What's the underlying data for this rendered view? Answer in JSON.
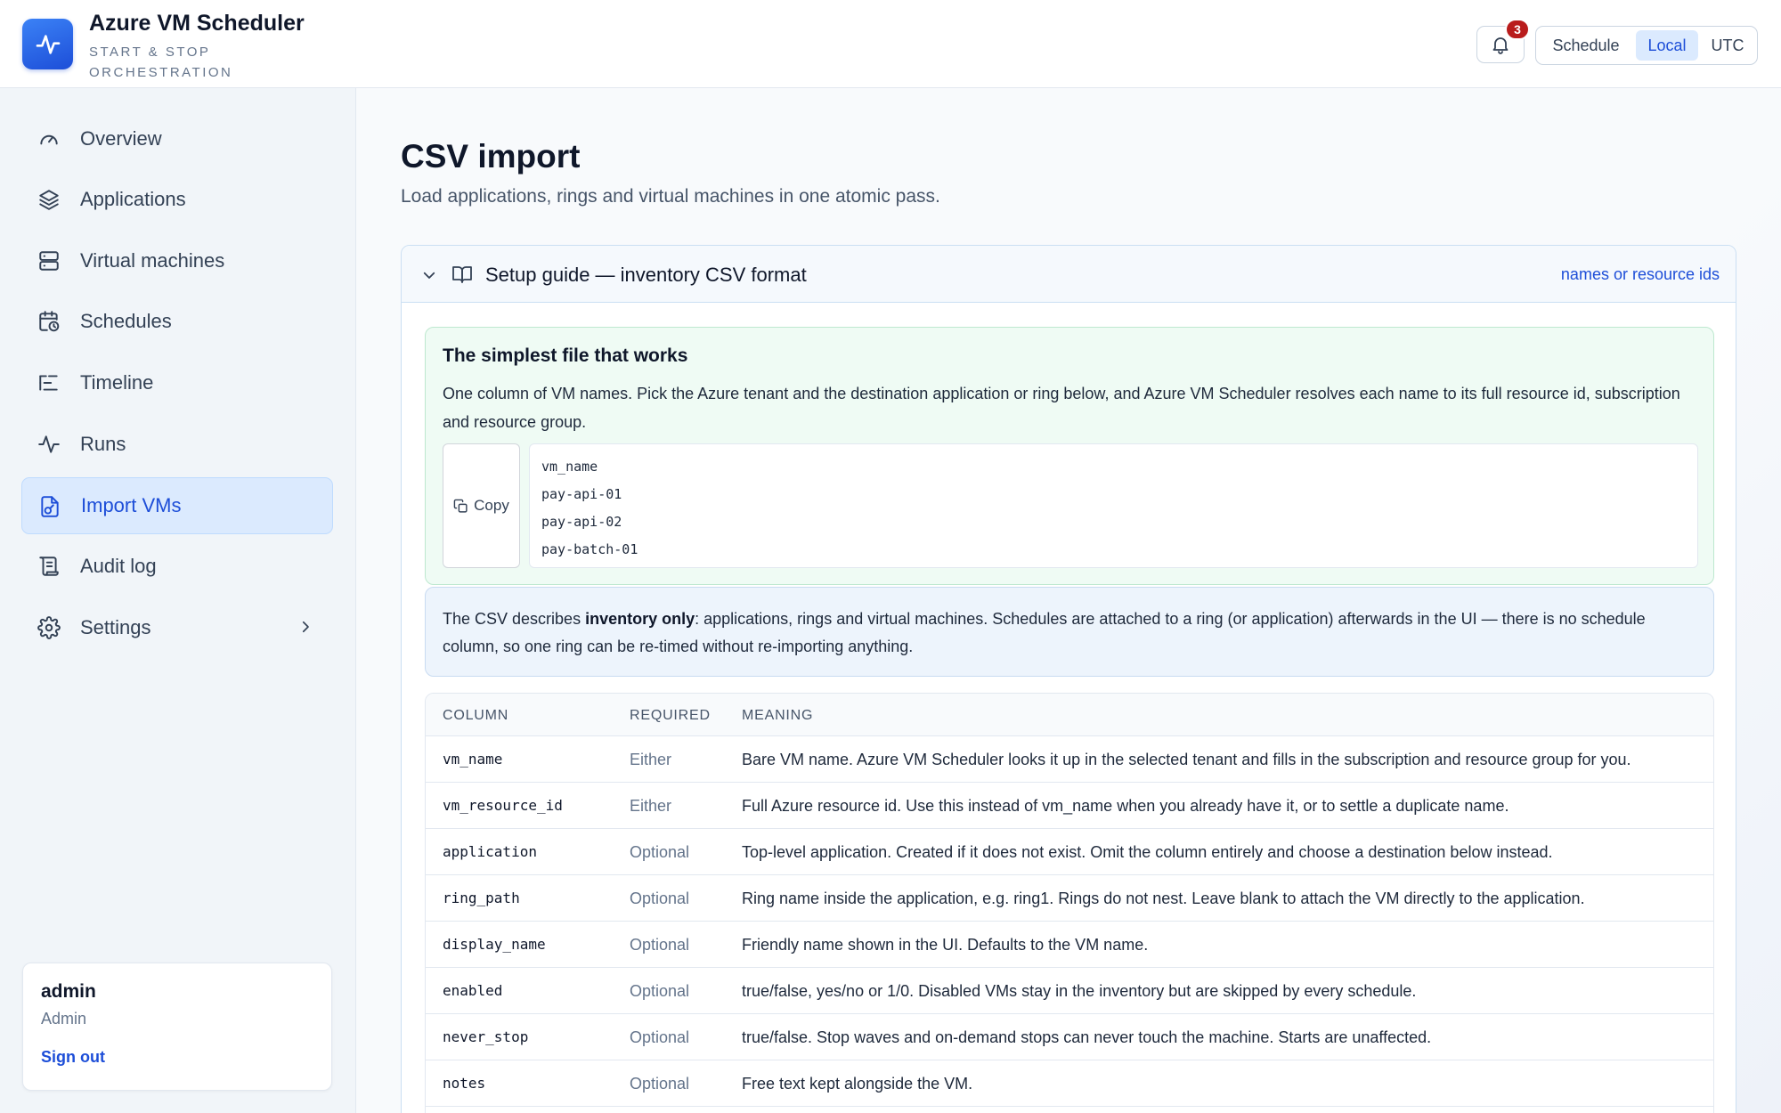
{
  "app": {
    "title": "Azure VM Scheduler",
    "subtitle": "START & STOP ORCHESTRATION",
    "notifications_count": "3"
  },
  "time_toggle": {
    "schedule_label": "Schedule",
    "local_label": "Local",
    "utc_label": "UTC",
    "active": "Local"
  },
  "sidebar": {
    "items": [
      {
        "label": "Overview",
        "icon": "gauge-icon"
      },
      {
        "label": "Applications",
        "icon": "layers-icon"
      },
      {
        "label": "Virtual machines",
        "icon": "server-icon"
      },
      {
        "label": "Schedules",
        "icon": "calendar-clock-icon"
      },
      {
        "label": "Timeline",
        "icon": "timeline-icon"
      },
      {
        "label": "Runs",
        "icon": "activity-icon"
      },
      {
        "label": "Import VMs",
        "icon": "file-import-icon",
        "active": true
      },
      {
        "label": "Audit log",
        "icon": "scroll-icon"
      },
      {
        "label": "Settings",
        "icon": "gear-icon"
      }
    ]
  },
  "user": {
    "name": "admin",
    "role": "Admin",
    "signout_label": "Sign out"
  },
  "page": {
    "title": "CSV import",
    "subtitle": "Load applications, rings and virtual machines in one atomic pass."
  },
  "guide": {
    "title": "Setup guide — inventory CSV format",
    "link": "names or resource ids",
    "simple": {
      "title": "The simplest file that works",
      "text": "One column of VM names. Pick the Azure tenant and the destination application or ring below, and Azure VM Scheduler resolves each name to its full resource id, subscription and resource group.",
      "copy_label": "Copy",
      "code_lines": [
        "vm_name",
        "pay-api-01",
        "pay-api-02",
        "pay-batch-01"
      ]
    },
    "info": {
      "prefix": "The CSV describes ",
      "bold": "inventory only",
      "suffix": ": applications, rings and virtual machines. Schedules are attached to a ring (or application) afterwards in the UI — there is no schedule column, so one ring can be re-timed without re-importing anything."
    },
    "table": {
      "headers": [
        "COLUMN",
        "REQUIRED",
        "MEANING"
      ],
      "rows": [
        {
          "column": "vm_name",
          "required": "Either",
          "meaning": "Bare VM name. Azure VM Scheduler looks it up in the selected tenant and fills in the subscription and resource group for you."
        },
        {
          "column": "vm_resource_id",
          "required": "Either",
          "meaning": "Full Azure resource id. Use this instead of vm_name when you already have it, or to settle a duplicate name."
        },
        {
          "column": "application",
          "required": "Optional",
          "meaning": "Top-level application. Created if it does not exist. Omit the column entirely and choose a destination below instead."
        },
        {
          "column": "ring_path",
          "required": "Optional",
          "meaning": "Ring name inside the application, e.g. ring1. Rings do not nest. Leave blank to attach the VM directly to the application."
        },
        {
          "column": "display_name",
          "required": "Optional",
          "meaning": "Friendly name shown in the UI. Defaults to the VM name."
        },
        {
          "column": "enabled",
          "required": "Optional",
          "meaning": "true/false, yes/no or 1/0. Disabled VMs stay in the inventory but are skipped by every schedule."
        },
        {
          "column": "never_stop",
          "required": "Optional",
          "meaning": "true/false. Stop waves and on-demand stops can never touch the machine. Starts are unaffected."
        },
        {
          "column": "notes",
          "required": "Optional",
          "meaning": "Free text kept alongside the VM."
        }
      ]
    }
  },
  "colors": {
    "accent": "#1d4ed8",
    "badge": "#b91c1c",
    "success_bg": "#effbf4",
    "info_bg": "#edf4fc"
  }
}
